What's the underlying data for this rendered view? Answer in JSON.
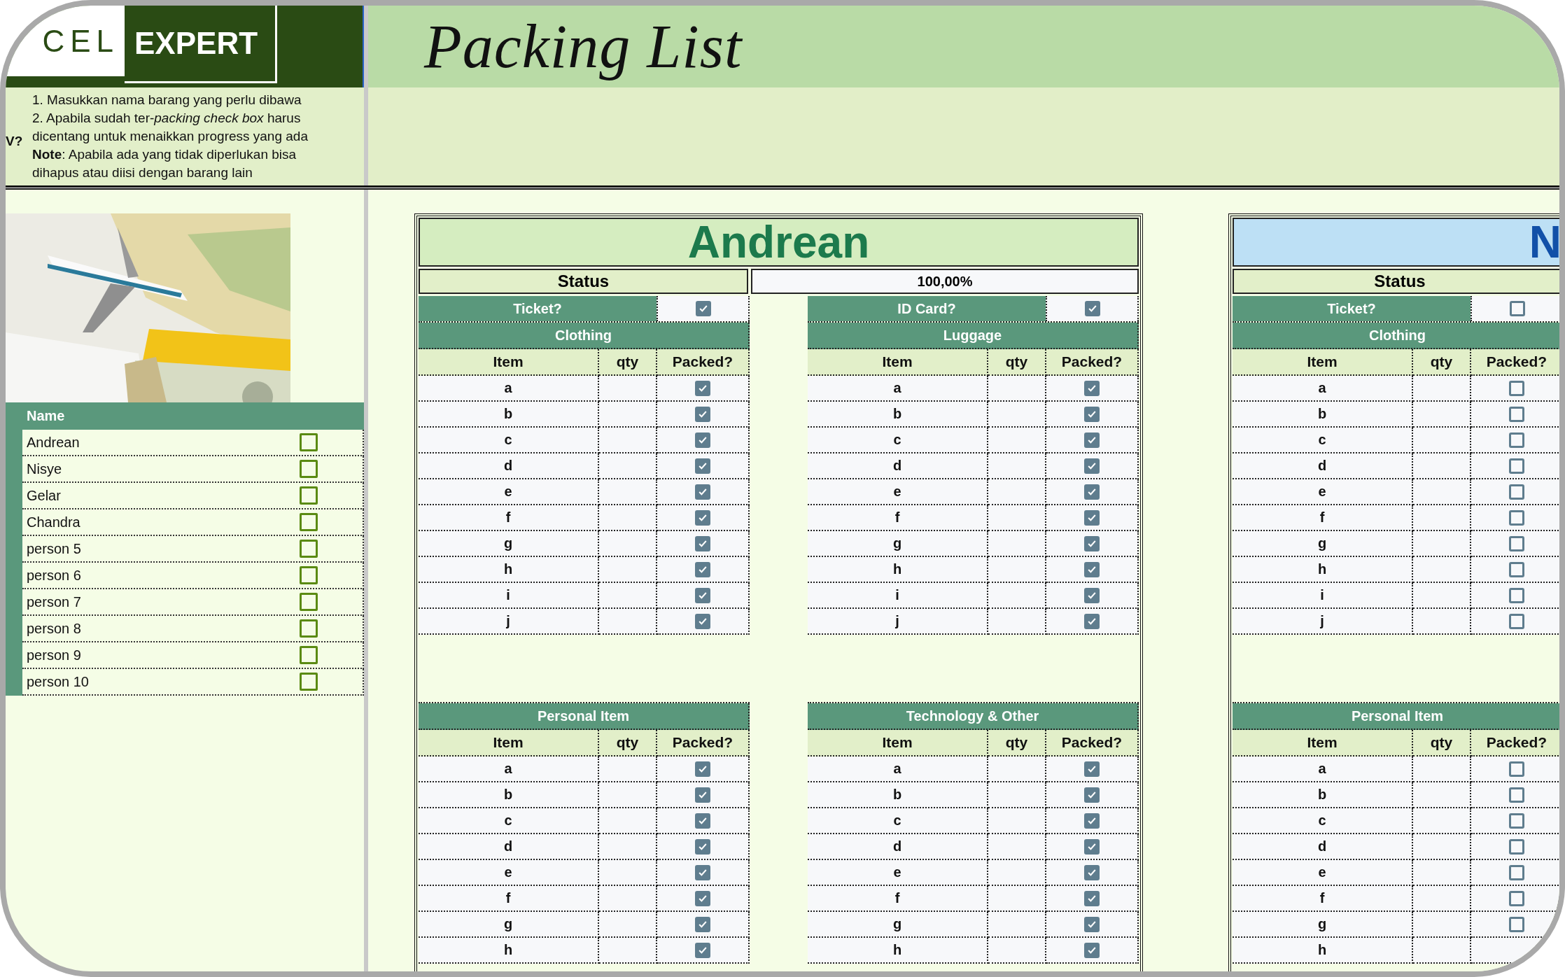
{
  "logo": {
    "light_part": "CEL",
    "dark_part": "EXPERT"
  },
  "title": "Packing List",
  "instructions": {
    "side_label": "V?",
    "lines": [
      "1. Masukkan nama barang yang perlu dibawa",
      "2. Apabila sudah ter-*packing check box* harus dicentang untuk menaikkan progress yang ada",
      "**Note**: Apabila ada yang tidak diperlukan bisa dihapus atau diisi dengan barang lain"
    ]
  },
  "names": {
    "header": "Name",
    "items": [
      {
        "name": "Andrean",
        "checked": false
      },
      {
        "name": "Nisye",
        "checked": false
      },
      {
        "name": "Gelar",
        "checked": false
      },
      {
        "name": "Chandra",
        "checked": false
      },
      {
        "name": "person 5",
        "checked": false
      },
      {
        "name": "person 6",
        "checked": false
      },
      {
        "name": "person 7",
        "checked": false
      },
      {
        "name": "person 8",
        "checked": false
      },
      {
        "name": "person 9",
        "checked": false
      },
      {
        "name": "person 10",
        "checked": false
      }
    ]
  },
  "cards": [
    {
      "name": "Andrean",
      "color": "#d5edc0",
      "status_label": "Status",
      "progress": "100,00%",
      "columns": [
        {
          "check": {
            "label": "Ticket?",
            "checked": true
          },
          "sections": [
            {
              "title": "Clothing",
              "headers": [
                "Item",
                "qty",
                "Packed?"
              ],
              "rows": [
                {
                  "item": "a",
                  "packed": true
                },
                {
                  "item": "b",
                  "packed": true
                },
                {
                  "item": "c",
                  "packed": true
                },
                {
                  "item": "d",
                  "packed": true
                },
                {
                  "item": "e",
                  "packed": true
                },
                {
                  "item": "f",
                  "packed": true
                },
                {
                  "item": "g",
                  "packed": true
                },
                {
                  "item": "h",
                  "packed": true
                },
                {
                  "item": "i",
                  "packed": true
                },
                {
                  "item": "j",
                  "packed": true
                }
              ]
            },
            {
              "title": "Personal Item",
              "headers": [
                "Item",
                "qty",
                "Packed?"
              ],
              "rows": [
                {
                  "item": "a",
                  "packed": true
                },
                {
                  "item": "b",
                  "packed": true
                },
                {
                  "item": "c",
                  "packed": true
                },
                {
                  "item": "d",
                  "packed": true
                },
                {
                  "item": "e",
                  "packed": true
                },
                {
                  "item": "f",
                  "packed": true
                },
                {
                  "item": "g",
                  "packed": true
                },
                {
                  "item": "h",
                  "packed": true
                }
              ]
            }
          ]
        },
        {
          "check": {
            "label": "ID Card?",
            "checked": true
          },
          "sections": [
            {
              "title": "Luggage",
              "headers": [
                "Item",
                "qty",
                "Packed?"
              ],
              "rows": [
                {
                  "item": "a",
                  "packed": true
                },
                {
                  "item": "b",
                  "packed": true
                },
                {
                  "item": "c",
                  "packed": true
                },
                {
                  "item": "d",
                  "packed": true
                },
                {
                  "item": "e",
                  "packed": true
                },
                {
                  "item": "f",
                  "packed": true
                },
                {
                  "item": "g",
                  "packed": true
                },
                {
                  "item": "h",
                  "packed": true
                },
                {
                  "item": "i",
                  "packed": true
                },
                {
                  "item": "j",
                  "packed": true
                }
              ]
            },
            {
              "title": "Technology & Other",
              "headers": [
                "Item",
                "qty",
                "Packed?"
              ],
              "rows": [
                {
                  "item": "a",
                  "packed": true
                },
                {
                  "item": "b",
                  "packed": true
                },
                {
                  "item": "c",
                  "packed": true
                },
                {
                  "item": "d",
                  "packed": true
                },
                {
                  "item": "e",
                  "packed": true
                },
                {
                  "item": "f",
                  "packed": true
                },
                {
                  "item": "g",
                  "packed": true
                },
                {
                  "item": "h",
                  "packed": true
                }
              ]
            }
          ]
        }
      ]
    },
    {
      "name": "N",
      "color": "#bde0f5",
      "status_label": "Status",
      "columns": [
        {
          "check": {
            "label": "Ticket?",
            "checked": false
          },
          "sections": [
            {
              "title": "Clothing",
              "headers": [
                "Item",
                "qty",
                "Packed?"
              ],
              "rows": [
                {
                  "item": "a",
                  "packed": false
                },
                {
                  "item": "b",
                  "packed": false
                },
                {
                  "item": "c",
                  "packed": false
                },
                {
                  "item": "d",
                  "packed": false
                },
                {
                  "item": "e",
                  "packed": false
                },
                {
                  "item": "f",
                  "packed": false
                },
                {
                  "item": "g",
                  "packed": false
                },
                {
                  "item": "h",
                  "packed": false
                },
                {
                  "item": "i",
                  "packed": false
                },
                {
                  "item": "j",
                  "packed": false
                }
              ]
            },
            {
              "title": "Personal Item",
              "headers": [
                "Item",
                "qty",
                "Packed?"
              ],
              "rows": [
                {
                  "item": "a",
                  "packed": false
                },
                {
                  "item": "b",
                  "packed": false
                },
                {
                  "item": "c",
                  "packed": false
                },
                {
                  "item": "d",
                  "packed": false
                },
                {
                  "item": "e",
                  "packed": false
                },
                {
                  "item": "f",
                  "packed": false
                },
                {
                  "item": "g",
                  "packed": false
                },
                {
                  "item": "h"
                }
              ]
            }
          ]
        }
      ]
    }
  ]
}
